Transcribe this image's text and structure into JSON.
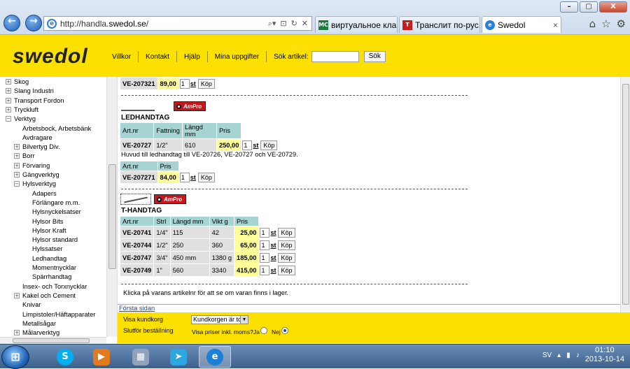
{
  "browser": {
    "address": {
      "prefix": "http://handla.",
      "domain": "swedol.se",
      "suffix": "/"
    },
    "tabs": [
      {
        "label": "виртуальное кла...",
        "favicon": "МС",
        "color": "#1b7a3e"
      },
      {
        "label": "Транслит по-рус...",
        "favicon": "T",
        "color": "#c41e1e"
      },
      {
        "label": "Swedol",
        "favicon": "e",
        "color": "#2a7fd4"
      }
    ],
    "window_buttons": {
      "minimize": "–",
      "maximize": "▢",
      "close": "X"
    }
  },
  "header": {
    "logo": "swedol",
    "menu": [
      "Villkor",
      "Kontakt",
      "Hjälp",
      "Mina uppgifter"
    ],
    "search_label": "Sök artikel:",
    "search_value": "",
    "search_button": "Sök"
  },
  "sidebar": {
    "nodes": [
      {
        "label": "Skog",
        "level": 0,
        "toggle": "+"
      },
      {
        "label": "Slang Industri",
        "level": 0,
        "toggle": "+"
      },
      {
        "label": "Transport Fordon",
        "level": 0,
        "toggle": "+"
      },
      {
        "label": "Tryckluft",
        "level": 0,
        "toggle": "+"
      },
      {
        "label": "Verktyg",
        "level": 0,
        "toggle": "−"
      },
      {
        "label": "Arbetsbock, Arbetsbänk",
        "level": 1,
        "toggle": ""
      },
      {
        "label": "Avdragare",
        "level": 1,
        "toggle": ""
      },
      {
        "label": "Bilvertyg Div.",
        "level": 1,
        "toggle": "+"
      },
      {
        "label": "Borr",
        "level": 1,
        "toggle": "+"
      },
      {
        "label": "Förvaring",
        "level": 1,
        "toggle": "+"
      },
      {
        "label": "Gängverktyg",
        "level": 1,
        "toggle": "+"
      },
      {
        "label": "Hylsverktyg",
        "level": 1,
        "toggle": "−"
      },
      {
        "label": "Adapers",
        "level": 2,
        "toggle": ""
      },
      {
        "label": "Förlängare m.m.",
        "level": 2,
        "toggle": ""
      },
      {
        "label": "Hylsnyckelsatser",
        "level": 2,
        "toggle": ""
      },
      {
        "label": "Hylsor Bits",
        "level": 2,
        "toggle": ""
      },
      {
        "label": "Hylsor Kraft",
        "level": 2,
        "toggle": ""
      },
      {
        "label": "Hylsor standard",
        "level": 2,
        "toggle": ""
      },
      {
        "label": "Hylssatser",
        "level": 2,
        "toggle": ""
      },
      {
        "label": "Ledhandtag",
        "level": 2,
        "toggle": ""
      },
      {
        "label": "Momentnycklar",
        "level": 2,
        "toggle": ""
      },
      {
        "label": "Spärrhandtag",
        "level": 2,
        "toggle": ""
      },
      {
        "label": "Insex- och Torxnycklar",
        "level": 1,
        "toggle": ""
      },
      {
        "label": "Kakel och Cement",
        "level": 1,
        "toggle": "+"
      },
      {
        "label": "Knivar",
        "level": 1,
        "toggle": ""
      },
      {
        "label": "Limpistoler/Häftapparater",
        "level": 1,
        "toggle": ""
      },
      {
        "label": "Metallsågar",
        "level": 1,
        "toggle": ""
      },
      {
        "label": "Målarverktyg",
        "level": 1,
        "toggle": "+"
      }
    ]
  },
  "content": {
    "qty_default": "1",
    "unit": "st",
    "buy_label": "Köp",
    "brand_badge": "AmPro",
    "top_row": {
      "art": "VE-207321",
      "price": "89,00"
    },
    "ledhandtag": {
      "title": "LEDHANDTAG",
      "headers": [
        "Art.nr",
        "Fattning",
        "Längd mm",
        "Pris"
      ],
      "rows": [
        [
          "VE-20727",
          "1/2\"",
          "610",
          "250,00"
        ]
      ],
      "note": "Huvud till ledhandtag till VE-20726, VE-20727 och VE-20729.",
      "sub_headers": [
        "Art.nr",
        "Pris"
      ],
      "sub_rows": [
        [
          "VE-207271",
          "84,00"
        ]
      ]
    },
    "thandtag": {
      "title": "T-HANDTAG",
      "headers": [
        "Art.nr",
        "Strl",
        "Längd mm",
        "Vikt g",
        "Pris"
      ],
      "rows": [
        [
          "VE-20741",
          "1/4\"",
          "115",
          "42",
          "25,00"
        ],
        [
          "VE-20744",
          "1/2\"",
          "250",
          "360",
          "65,00"
        ],
        [
          "VE-20747",
          "3/4\"",
          "450 mm",
          "1380 g",
          "185,00"
        ],
        [
          "VE-20749",
          "1\"",
          "560",
          "3340",
          "415,00"
        ]
      ]
    },
    "stock_note": "Klicka på varans artikelnr för att se om varan finns i lager.",
    "first_page_link": "Första sidan"
  },
  "footer": {
    "cart_label": "Visa kundkorg",
    "cart_select": "Kundkorgen är tom",
    "checkout_label": "Slutför beställning",
    "vat_label": "Visa priser inkl. moms?",
    "yes": "Ja",
    "no": "Nej"
  },
  "taskbar": {
    "start": "⊞",
    "apps": [
      "skype-icon",
      "media-player-icon",
      "calculator-icon",
      "telegram-icon",
      "internet-explorer-icon"
    ],
    "lang": "SV",
    "time": "01:10",
    "date": "2013-10-14"
  }
}
